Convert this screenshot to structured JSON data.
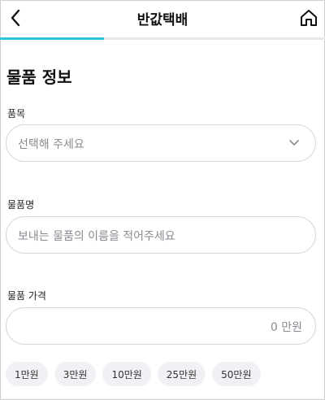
{
  "header": {
    "title": "반값택배"
  },
  "progress": {
    "fraction": 0.32
  },
  "section": {
    "title": "물품 정보"
  },
  "fields": {
    "item_type": {
      "label": "품목",
      "placeholder": "선택해 주세요"
    },
    "item_name": {
      "label": "물품명",
      "placeholder": "보내는 물품의 이름을 적어주세요"
    },
    "item_price": {
      "label": "물품 가격",
      "value_text": "0 만원"
    }
  },
  "quick_prices": [
    "1만원",
    "3만원",
    "10만원",
    "25만원",
    "50만원"
  ],
  "icons": {
    "back": "back-arrow-icon",
    "home": "home-icon",
    "dropdown": "chevron-down-icon"
  },
  "colors": {
    "accent": "#2fc4d9"
  }
}
